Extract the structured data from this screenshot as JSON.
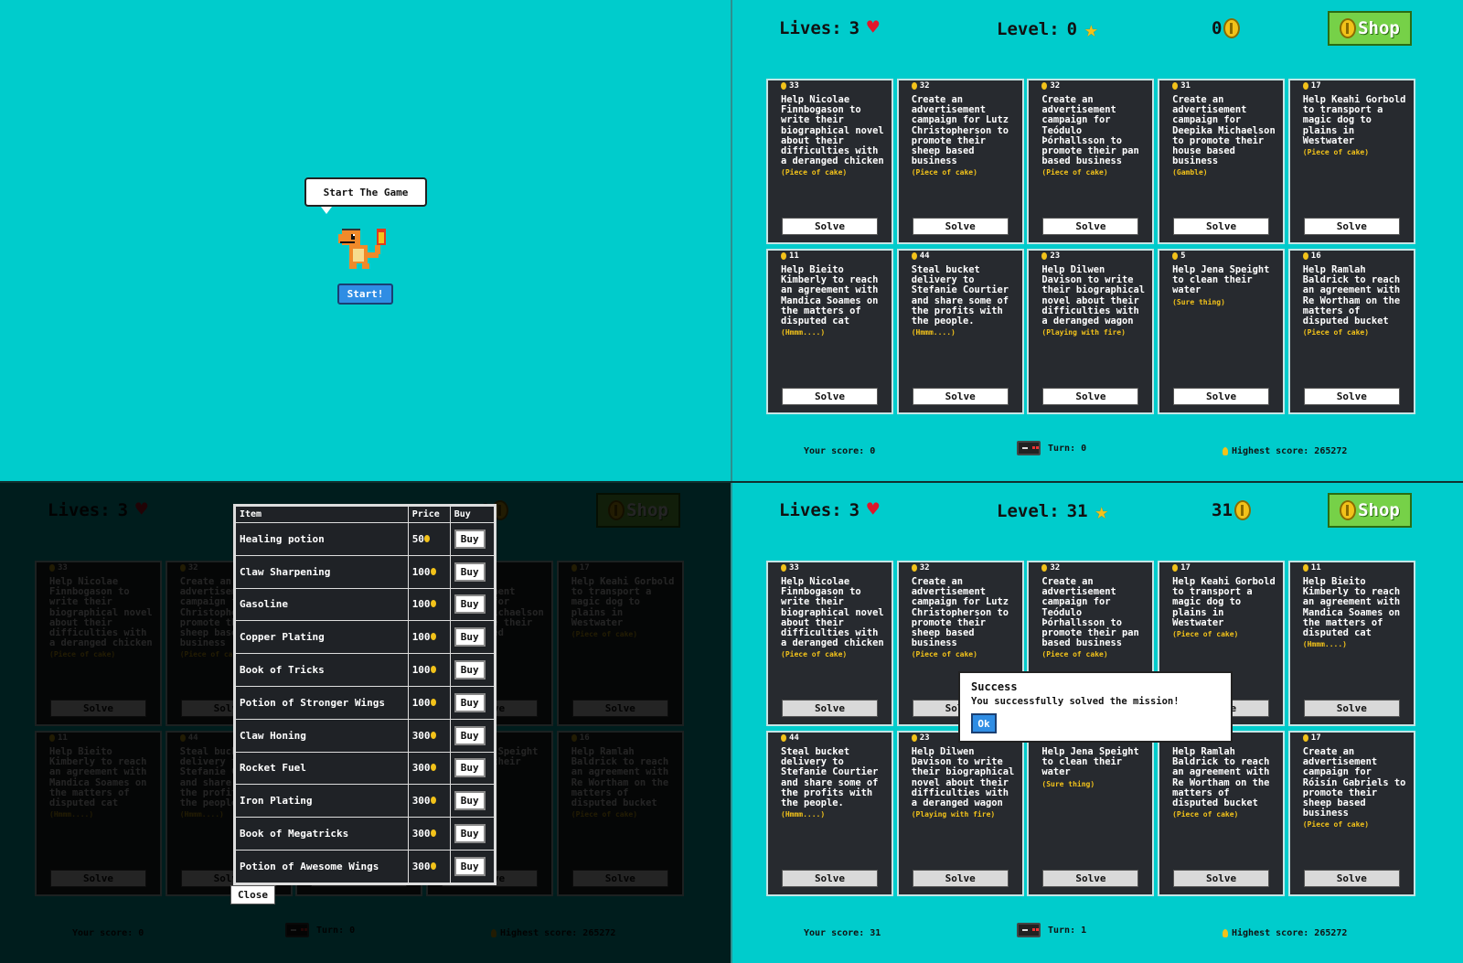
{
  "start_screen": {
    "bubble_text": "Start The Game",
    "start_label": "Start!"
  },
  "colors": {
    "background": "#00cccc",
    "card": "#272a2f",
    "difficulty": "#f2c21a",
    "shop_button": "#76d148",
    "start_button": "#2f8de4"
  },
  "state_initial": {
    "hud": {
      "lives_label": "Lives:",
      "lives": "3",
      "level_label": "Level:",
      "level": "0",
      "coins": "0",
      "shop_label": "Shop"
    },
    "footer": {
      "score": "Your score: 0",
      "turn": "Turn: 0",
      "high": "Highest score: 265272"
    },
    "cards": [
      {
        "price": "33",
        "title": "Help Nicolae Finnbogason to write their biographical novel about their difficulties with a deranged chicken",
        "difficulty": "(Piece of cake)",
        "solve": "Solve"
      },
      {
        "price": "32",
        "title": "Create an advertisement campaign for Lutz Christopherson to promote their sheep based business",
        "difficulty": "(Piece of cake)",
        "solve": "Solve"
      },
      {
        "price": "32",
        "title": "Create an advertisement campaign for Teódulo Þórhallsson to promote their pan based business",
        "difficulty": "(Piece of cake)",
        "solve": "Solve"
      },
      {
        "price": "31",
        "title": "Create an advertisement campaign for Deepika Michaelson to promote their house based business",
        "difficulty": "(Gamble)",
        "solve": "Solve"
      },
      {
        "price": "17",
        "title": "Help Keahi Gorbold to transport a magic dog to plains in Westwater",
        "difficulty": "(Piece of cake)",
        "solve": "Solve"
      },
      {
        "price": "11",
        "title": "Help Bieito Kimberly to reach an agreement with Mandica Soames on the matters of disputed cat",
        "difficulty": "(Hmmm....)",
        "solve": "Solve"
      },
      {
        "price": "44",
        "title": "Steal bucket delivery to Stefanie Courtier and share some of the profits with the people.",
        "difficulty": "(Hmmm....)",
        "solve": "Solve"
      },
      {
        "price": "23",
        "title": "Help Dilwen Davison to write their biographical novel about their difficulties with a deranged wagon",
        "difficulty": "(Playing with fire)",
        "solve": "Solve"
      },
      {
        "price": "5",
        "title": "Help Jena Speight to clean their water",
        "difficulty": "(Sure thing)",
        "solve": "Solve"
      },
      {
        "price": "16",
        "title": "Help Ramlah Baldrick to reach an agreement with Re Wortham on the matters of disputed bucket",
        "difficulty": "(Piece of cake)",
        "solve": "Solve"
      }
    ]
  },
  "shop": {
    "headers": {
      "item": "Item",
      "price": "Price",
      "buy": "Buy"
    },
    "buy_label": "Buy",
    "close_label": "Close",
    "items": [
      {
        "name": "Healing potion",
        "price": "50"
      },
      {
        "name": "Claw Sharpening",
        "price": "100"
      },
      {
        "name": "Gasoline",
        "price": "100"
      },
      {
        "name": "Copper Plating",
        "price": "100"
      },
      {
        "name": "Book of Tricks",
        "price": "100"
      },
      {
        "name": "Potion of Stronger Wings",
        "price": "100"
      },
      {
        "name": "Claw Honing",
        "price": "300"
      },
      {
        "name": "Rocket Fuel",
        "price": "300"
      },
      {
        "name": "Iron Plating",
        "price": "300"
      },
      {
        "name": "Book of Megatricks",
        "price": "300"
      },
      {
        "name": "Potion of Awesome Wings",
        "price": "300"
      }
    ]
  },
  "state_after": {
    "hud": {
      "lives_label": "Lives:",
      "lives": "3",
      "level_label": "Level:",
      "level": "31",
      "coins": "31",
      "shop_label": "Shop"
    },
    "footer": {
      "score": "Your score: 31",
      "turn": "Turn: 1",
      "high": "Highest score: 265272"
    },
    "cards": [
      {
        "price": "33",
        "title": "Help Nicolae Finnbogason to write their biographical novel about their difficulties with a deranged chicken",
        "difficulty": "(Piece of cake)",
        "solve": "Solve"
      },
      {
        "price": "32",
        "title": "Create an advertisement campaign for Lutz Christopherson to promote their sheep based business",
        "difficulty": "(Piece of cake)",
        "solve": "Solve"
      },
      {
        "price": "32",
        "title": "Create an advertisement campaign for Teódulo Þórhallsson to promote their pan based business",
        "difficulty": "(Piece of cake)",
        "solve": "Solve"
      },
      {
        "price": "17",
        "title": "Help Keahi Gorbold to transport a magic dog to plains in Westwater",
        "difficulty": "(Piece of cake)",
        "solve": "Solve"
      },
      {
        "price": "11",
        "title": "Help Bieito Kimberly to reach an agreement with Mandica Soames on the matters of disputed cat",
        "difficulty": "(Hmmm....)",
        "solve": "Solve"
      },
      {
        "price": "44",
        "title": "Steal bucket delivery to Stefanie Courtier and share some of the profits with the people.",
        "difficulty": "(Hmmm....)",
        "solve": "Solve"
      },
      {
        "price": "23",
        "title": "Help Dilwen Davison to write their biographical novel about their difficulties with a deranged wagon",
        "difficulty": "(Playing with fire)",
        "solve": "Solve"
      },
      {
        "price": "5",
        "title": "Help Jena Speight to clean their water",
        "difficulty": "(Sure thing)",
        "solve": "Solve"
      },
      {
        "price": "16",
        "title": "Help Ramlah Baldrick to reach an agreement with Re Wortham on the matters of disputed bucket",
        "difficulty": "(Piece of cake)",
        "solve": "Solve"
      },
      {
        "price": "17",
        "title": "Create an advertisement campaign for Róisín Gabriels to promote their sheep based business",
        "difficulty": "(Piece of cake)",
        "solve": "Solve"
      }
    ],
    "dialog": {
      "title": "Success",
      "message": "You successfully solved the mission!",
      "ok_label": "Ok"
    }
  }
}
